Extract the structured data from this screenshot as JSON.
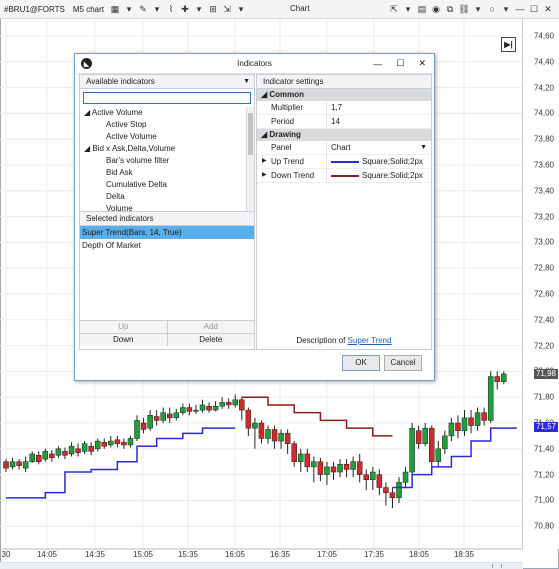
{
  "toolbar": {
    "symbol": "#BRU1@FORTS",
    "timeframe": "M5 chart",
    "title": "Chart"
  },
  "chart": {
    "y_labels": [
      "74,60",
      "74,40",
      "74,20",
      "74,00",
      "73,80",
      "73,60",
      "73,40",
      "73,20",
      "73,00",
      "72,80",
      "72,60",
      "72,40",
      "72,20",
      "72,00",
      "71,80",
      "71,60",
      "71,40",
      "71,20",
      "71,00",
      "70,80"
    ],
    "x_labels": [
      "30",
      "14:05",
      "14:35",
      "15:05",
      "15:35",
      "16:05",
      "16:35",
      "17:05",
      "17:35",
      "18:05",
      "18:35"
    ],
    "last_price": "71,98",
    "supertrend_value": "71,57",
    "colors": {
      "bull": "#1f9e3a",
      "bear": "#d12a2a",
      "trend_up": "#2a2ad8",
      "trend_down": "#8b1a1a"
    }
  },
  "dialog": {
    "title": "Indicators",
    "available_label": "Available indicators",
    "search_value": "",
    "tree": [
      {
        "label": "Active Volume",
        "group": true
      },
      {
        "label": "Active Stop",
        "group": false
      },
      {
        "label": "Active Volume",
        "group": false
      },
      {
        "label": "Bid x Ask,Delta,Volume",
        "group": true
      },
      {
        "label": "Bar's volume filter",
        "group": false
      },
      {
        "label": "Bid Ask",
        "group": false
      },
      {
        "label": "Cumulative Delta",
        "group": false
      },
      {
        "label": "Delta",
        "group": false
      },
      {
        "label": "Volume",
        "group": false
      }
    ],
    "selected_label": "Selected indicators",
    "selected": [
      "Super Trend(Bars, 14, True)",
      "Depth Of Market"
    ],
    "buttons": {
      "up": "Up",
      "add": "Add",
      "down": "Down",
      "delete": "Delete"
    },
    "settings_label": "Indicator settings",
    "common_label": "Common",
    "multiplier_label": "Multiplier",
    "multiplier_value": "1,7",
    "period_label": "Period",
    "period_value": "14",
    "drawing_label": "Drawing",
    "panel_label": "Panel",
    "panel_value": "Chart",
    "uptrend_label": "Up Trend",
    "uptrend_value": "Square;Solid;2px",
    "downtrend_label": "Down Trend",
    "downtrend_value": "Square;Solid;2px",
    "description_prefix": "Description of ",
    "description_link": "Super Trend",
    "ok": "OK",
    "cancel": "Cancel"
  }
}
